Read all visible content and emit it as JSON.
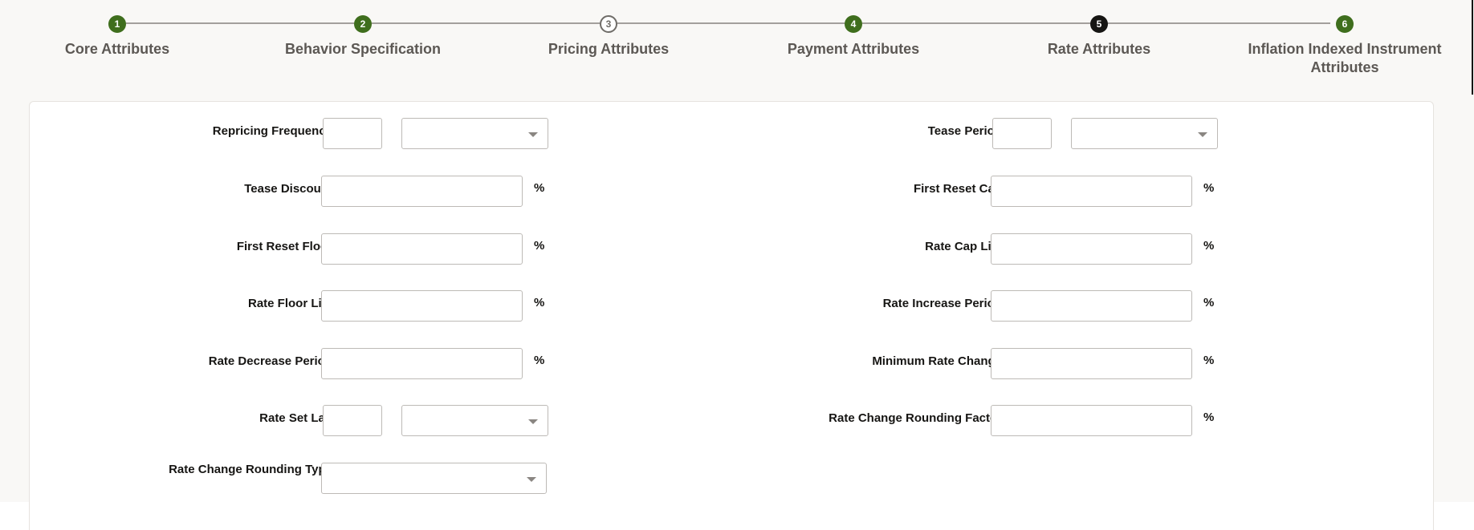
{
  "train": {
    "steps": [
      {
        "number": "1",
        "label": "Core Attributes",
        "status": "done"
      },
      {
        "number": "2",
        "label": "Behavior Specification",
        "status": "done"
      },
      {
        "number": "3",
        "label": "Pricing Attributes",
        "status": "pending"
      },
      {
        "number": "4",
        "label": "Payment Attributes",
        "status": "done"
      },
      {
        "number": "5",
        "label": "Rate Attributes",
        "status": "active"
      },
      {
        "number": "6",
        "label": "Inflation Indexed Instrument Attributes",
        "status": "done"
      }
    ]
  },
  "colors": {
    "done": "#3f6e1d",
    "active": "#161513",
    "pending_border": "#6f6c68",
    "connector": "#a3a09d"
  },
  "percent_symbol": "%",
  "form": {
    "left": {
      "repricing_frequency": {
        "label": "Repricing Frequency",
        "value": "",
        "unit": ""
      },
      "tease_discount": {
        "label": "Tease Discount",
        "value": ""
      },
      "first_reset_floor": {
        "label": "First Reset Floor",
        "value": ""
      },
      "rate_floor_life": {
        "label": "Rate Floor Life",
        "value": ""
      },
      "rate_decrease_period": {
        "label": "Rate Decrease Period",
        "value": ""
      },
      "rate_set_lag": {
        "label": "Rate Set Lag",
        "value": "",
        "unit": ""
      },
      "rate_change_rounding_type": {
        "label": "Rate Change Rounding Type",
        "value": ""
      }
    },
    "right": {
      "tease_period": {
        "label": "Tease Period",
        "value": "",
        "unit": ""
      },
      "first_reset_cap": {
        "label": "First Reset Cap",
        "value": ""
      },
      "rate_cap_life": {
        "label": "Rate Cap Life",
        "value": ""
      },
      "rate_increase_period": {
        "label": "Rate Increase Period",
        "value": ""
      },
      "minimum_rate_change": {
        "label": "Minimum Rate Change",
        "value": ""
      },
      "rate_change_rounding_factor": {
        "label": "Rate Change Rounding Factor",
        "value": ""
      }
    }
  }
}
